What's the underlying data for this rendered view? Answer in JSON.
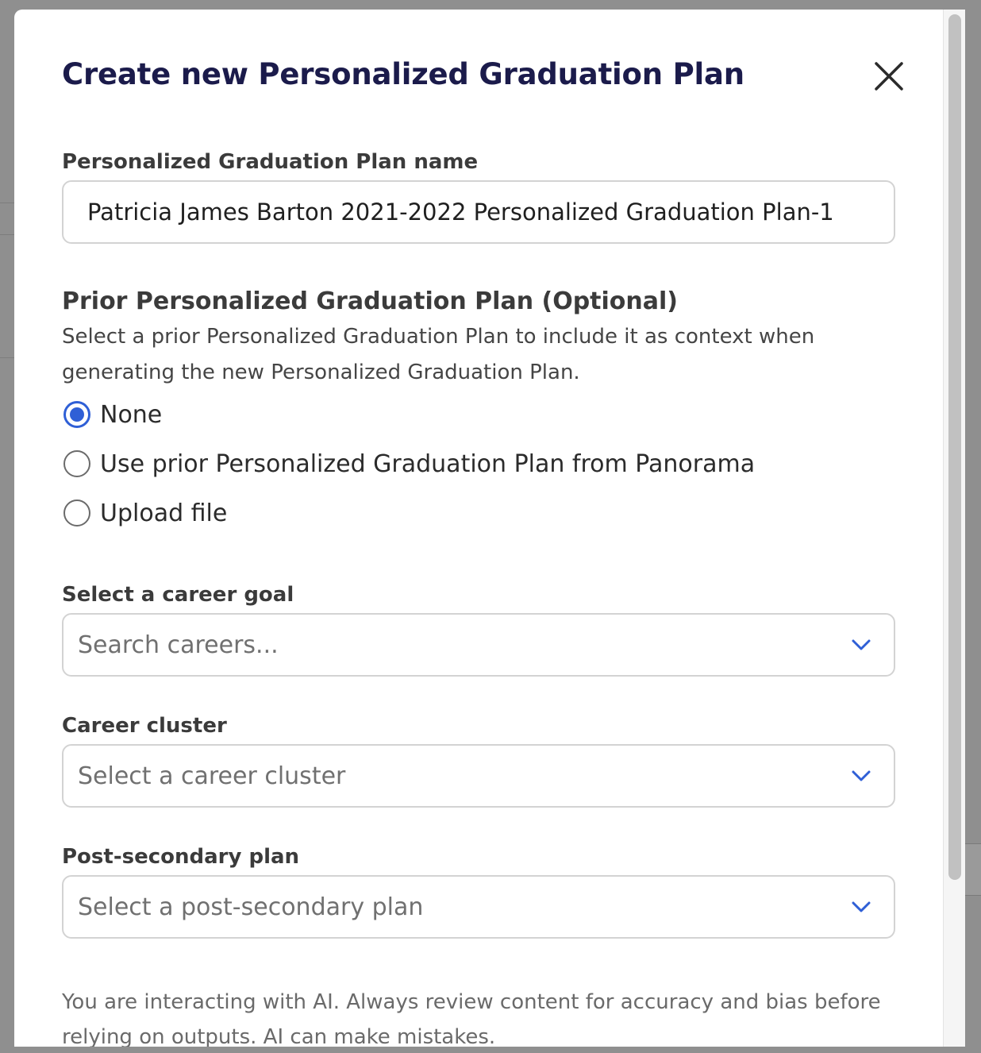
{
  "modal": {
    "title": "Create new Personalized Graduation Plan",
    "close_icon": "close-icon",
    "plan_name": {
      "label": "Personalized Graduation Plan name",
      "value": "Patricia James Barton 2021-2022 Personalized Graduation Plan-1"
    },
    "prior_plan": {
      "title": "Prior Personalized Graduation Plan (Optional)",
      "description": "Select a prior Personalized Graduation Plan to include it as context when generating the new Personalized Graduation Plan.",
      "options": [
        {
          "label": "None",
          "checked": true
        },
        {
          "label": "Use prior Personalized Graduation Plan from Panorama",
          "checked": false
        },
        {
          "label": "Upload file",
          "checked": false
        }
      ]
    },
    "career_goal": {
      "label": "Select a career goal",
      "placeholder": "Search careers..."
    },
    "career_cluster": {
      "label": "Career cluster",
      "placeholder": "Select a career cluster"
    },
    "post_secondary": {
      "label": "Post-secondary plan",
      "placeholder": "Select a post-secondary plan"
    },
    "disclaimer": "You are interacting with AI. Always review content for accuracy and bias before relying on outputs. AI can make mistakes."
  },
  "colors": {
    "title": "#1b1b4b",
    "accent": "#2f5fd6",
    "overlay": "#8f8f8f"
  }
}
